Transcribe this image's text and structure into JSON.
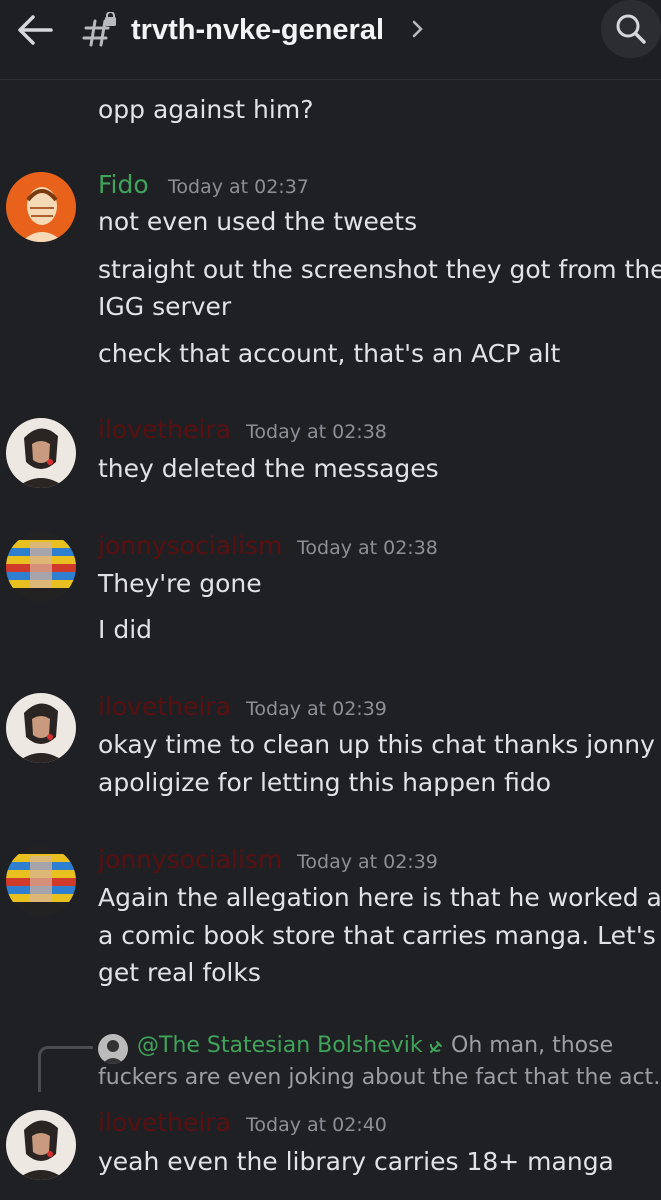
{
  "header": {
    "channel_name": "trvth-nvke-general",
    "back_icon": "arrow-left-icon",
    "channel_icon": "locked-hash-icon",
    "chevron_icon": "chevron-right-icon",
    "search_icon": "search-icon"
  },
  "colors": {
    "background": "#1f2024",
    "text": "#e1e2e6",
    "timestamp": "#8d8f97",
    "fido": "#3fa45a",
    "dark_red": "#5a1010",
    "reply_name": "#3fa45a"
  },
  "top_fragment": "opp against him?",
  "messages": [
    {
      "author": "Fido",
      "time": "Today at 02:37",
      "lines": [
        "not even used the tweets",
        "straight out the screenshot they got from the",
        "IGG server",
        "check that account, that's an ACP alt"
      ]
    },
    {
      "author": "ilovetheira",
      "time": "Today at 02:38",
      "lines": [
        "they deleted the messages"
      ]
    },
    {
      "author": "jonnysocialism",
      "time": "Today at 02:38",
      "lines": [
        "They're gone",
        "I did"
      ]
    },
    {
      "author": "ilovetheira",
      "time": "Today at 02:39",
      "lines": [
        "okay time to clean up this chat thanks jonny i",
        "apoligize for letting this happen fido"
      ]
    },
    {
      "author": "jonnysocialism",
      "time": "Today at 02:39",
      "lines": [
        "Again the allegation here is that he worked at",
        "a comic book store that carries manga. Let's",
        "get real folks"
      ]
    },
    {
      "author": "ilovetheira",
      "time": "Today at 02:40",
      "reply": {
        "name": "@The Statesian Bolshevik",
        "badge_icon": "hammer-sickle-icon",
        "text_line1": "Oh man, those",
        "text_line2": "fuckers are even joking about the fact that the act…"
      },
      "lines": [
        "yeah even the library carries 18+ manga"
      ]
    }
  ]
}
